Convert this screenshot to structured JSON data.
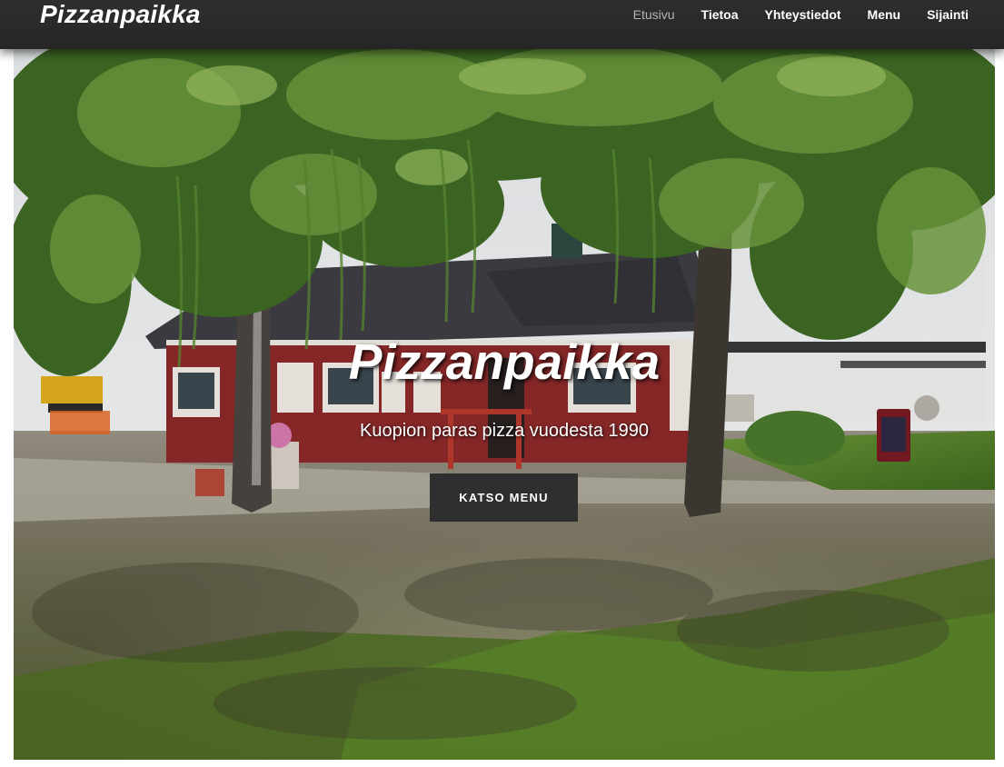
{
  "header": {
    "brand": "Pizzanpaikka",
    "nav": [
      {
        "label": "Etusivu",
        "active": true
      },
      {
        "label": "Tietoa",
        "active": false
      },
      {
        "label": "Yhteystiedot",
        "active": false
      },
      {
        "label": "Menu",
        "active": false
      },
      {
        "label": "Sijainti",
        "active": false
      }
    ]
  },
  "hero": {
    "title": "Pizzanpaikka",
    "subtitle": "Kuopion paras pizza vuodesta 1990",
    "button_label": "KATSO MENU"
  },
  "colors": {
    "navbar": "#2b2b2b",
    "nav_active": "#b4b4b4",
    "button": "#2f2f2f",
    "house_red": "#8e2a2a"
  }
}
